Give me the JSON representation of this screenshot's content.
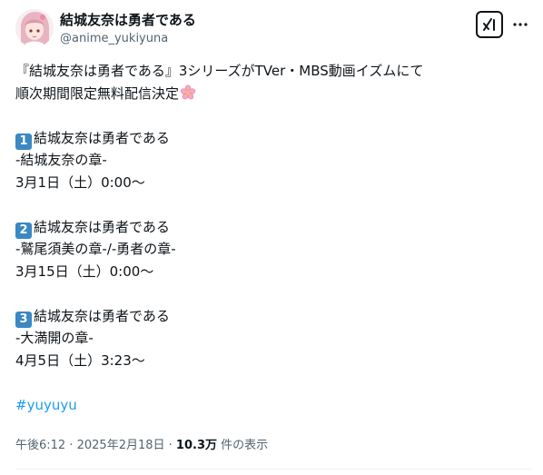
{
  "author": {
    "name": "結城友奈は勇者である",
    "handle": "@anime_yukiyuna"
  },
  "icons": {
    "avatar": "anime-girl-avatar",
    "grok": "grok-icon",
    "more": "more-dots-icon",
    "blossom": "cherry-blossom-emoji",
    "keycap_1": "keycap-1",
    "keycap_2": "keycap-2",
    "keycap_3": "keycap-3"
  },
  "tweet": {
    "line1": "『結城友奈は勇者である』3シリーズがTVer・MBS動画イズムにて",
    "line2": "順次期間限定無料配信決定",
    "items": [
      {
        "key": "1",
        "title": "結城友奈は勇者である",
        "subtitle": "-結城友奈の章-",
        "date": "3月1日（土）0:00〜"
      },
      {
        "key": "2",
        "title": "結城友奈は勇者である",
        "subtitle": "-鷲尾須美の章-/-勇者の章-",
        "date": "3月15日（土）0:00〜"
      },
      {
        "key": "3",
        "title": "結城友奈は勇者である",
        "subtitle": "-大満開の章-",
        "date": "4月5日（土）3:23〜"
      }
    ],
    "hashtag": "#yuyuyu"
  },
  "meta": {
    "time": "午後6:12",
    "separator": " · ",
    "date": "2025年2月18日",
    "views": "10.3万",
    "views_label": " 件の表示"
  },
  "colors": {
    "text": "#0f1419",
    "secondary": "#536471",
    "link": "#1d9bf0",
    "keycap": "#3b88c3",
    "divider": "#eff3f4"
  }
}
